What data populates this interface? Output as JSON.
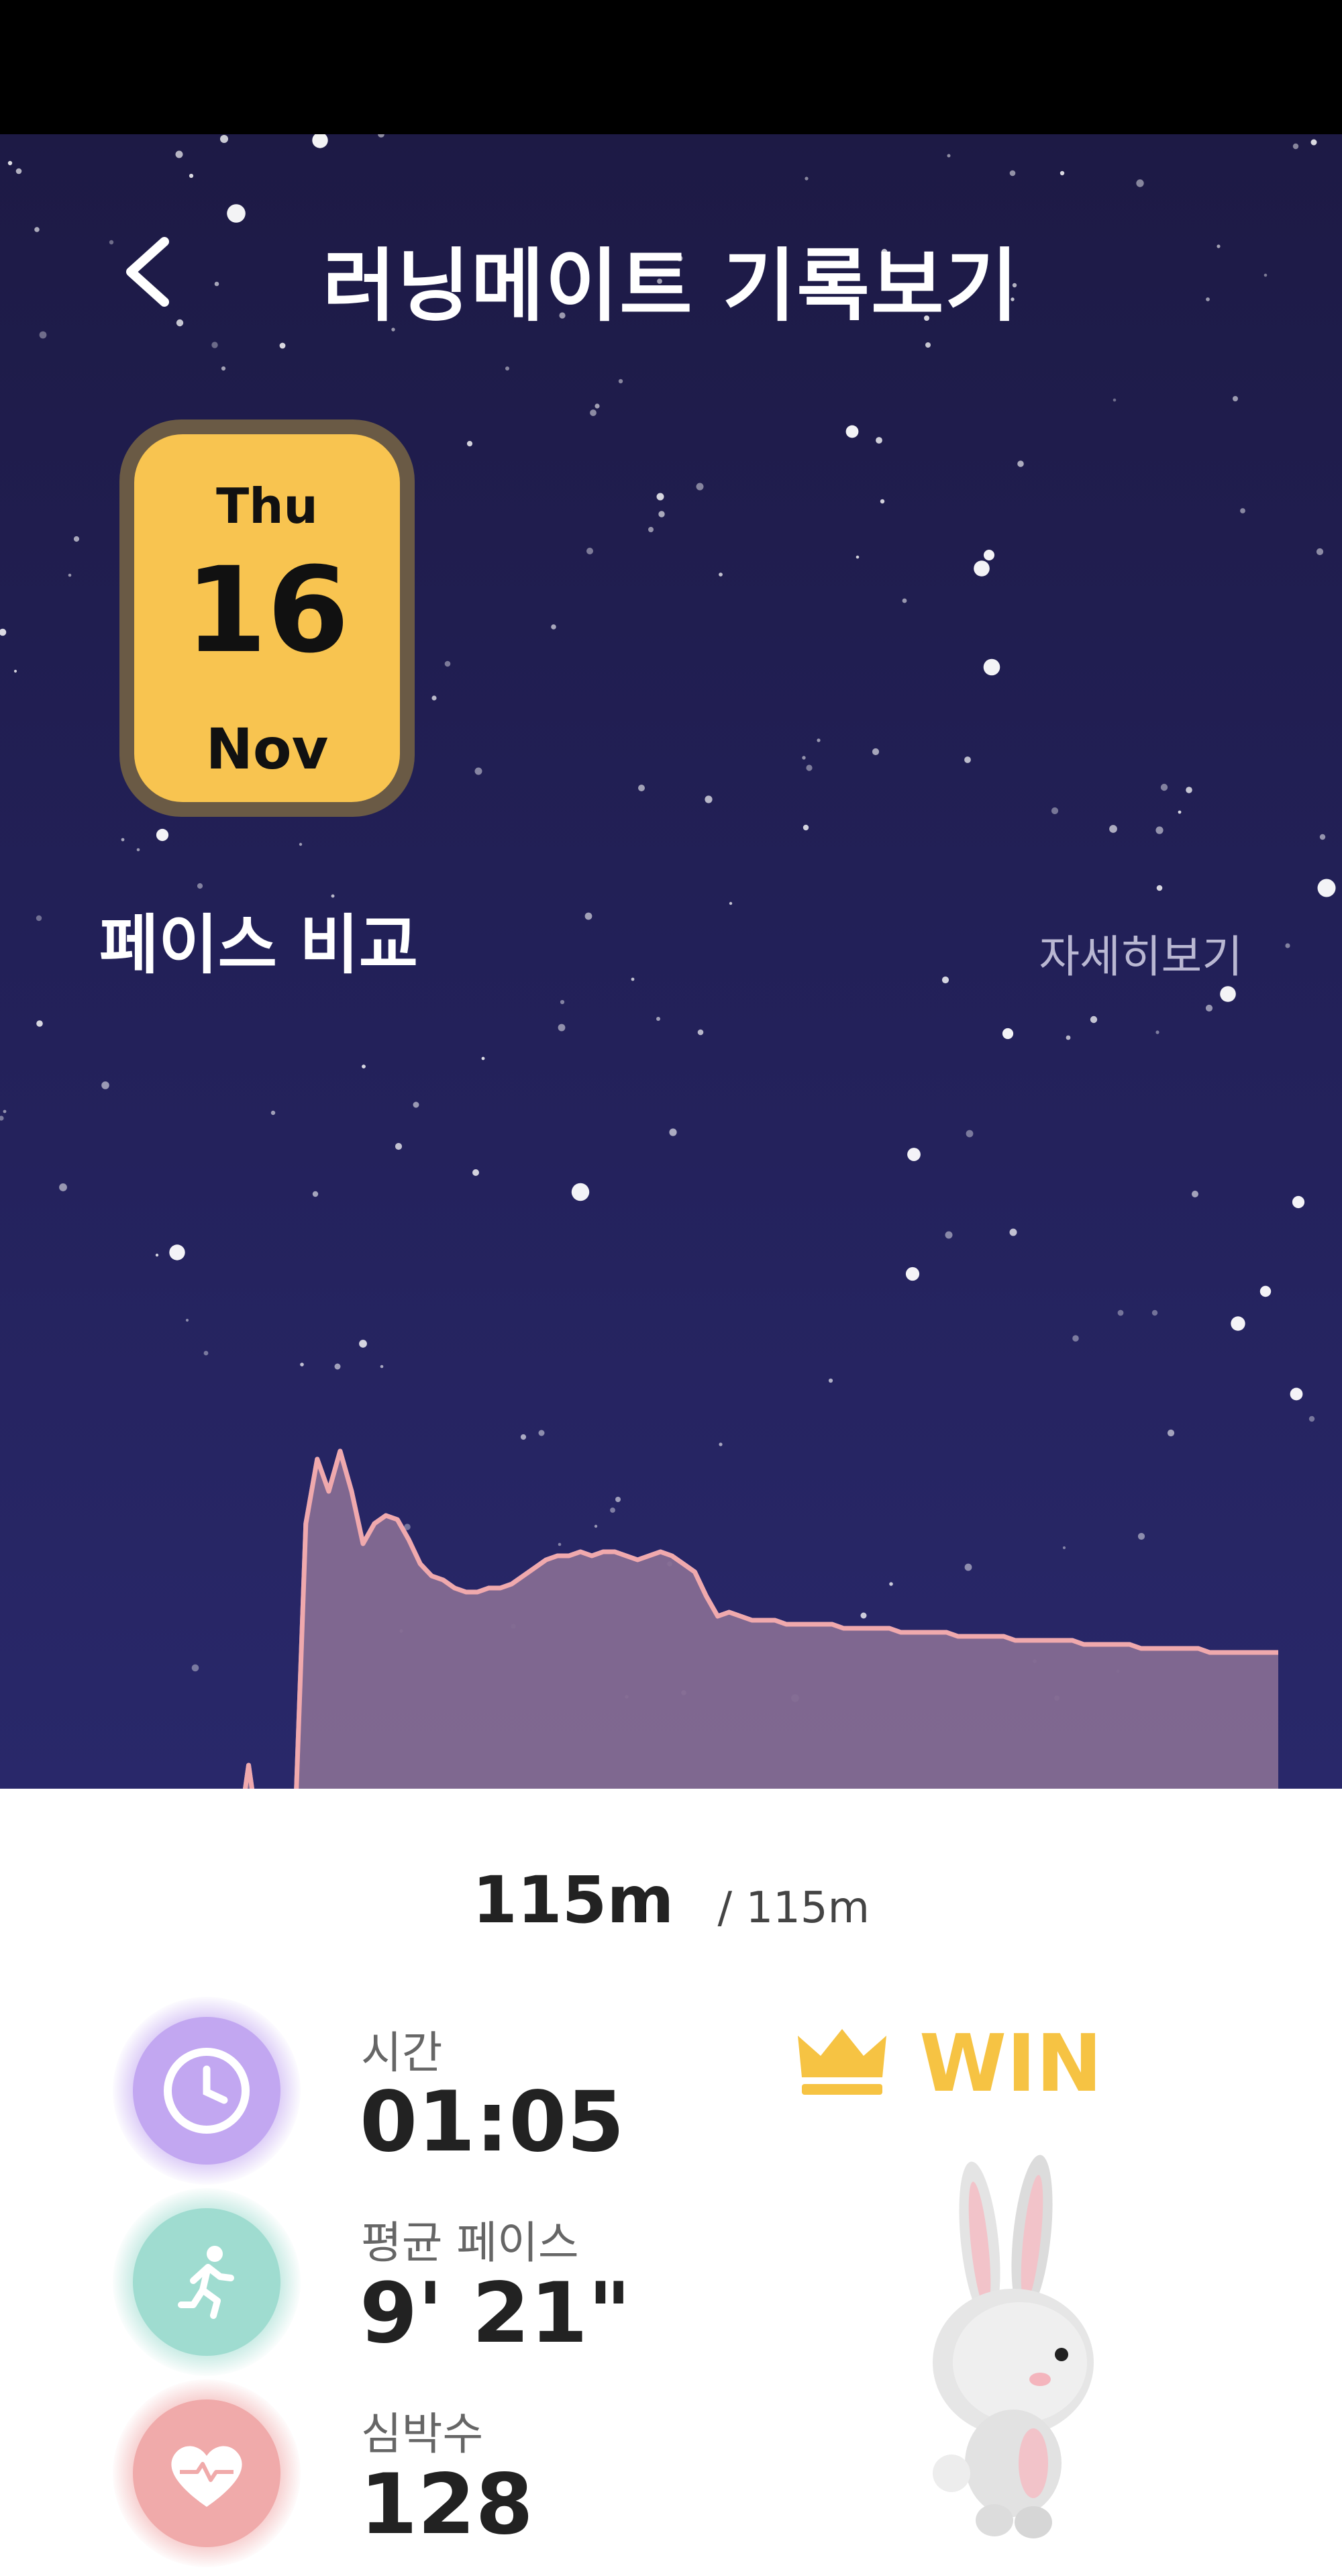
{
  "header": {
    "title": "러닝메이트 기록보기",
    "back_icon": "chevron-left-icon"
  },
  "date_card": {
    "weekday": "Thu",
    "day": "16",
    "month": "Nov"
  },
  "pace_section": {
    "title": "페이스 비교",
    "detail_link": "자세히보기"
  },
  "chart_data": {
    "type": "area",
    "title": "",
    "xlabel": "",
    "ylabel": "",
    "grid": false,
    "x": [
      0,
      1,
      2,
      3,
      4,
      5,
      6,
      7,
      8,
      9,
      10,
      11,
      12,
      13,
      14,
      15,
      16,
      17,
      18,
      19,
      20,
      21,
      22,
      23,
      24,
      25,
      26,
      27,
      28,
      29,
      30,
      31,
      32,
      33,
      34,
      35,
      36,
      37,
      38,
      39,
      40,
      41,
      42,
      43,
      44,
      45,
      46,
      47,
      48,
      49,
      50,
      51,
      52,
      53,
      54,
      55,
      56,
      57,
      58,
      59,
      60,
      61,
      62,
      63,
      64,
      65,
      66,
      67,
      68,
      69,
      70,
      71,
      72,
      73,
      74,
      75,
      76,
      77,
      78,
      79,
      80,
      81,
      82,
      83,
      84,
      85,
      86,
      87,
      88,
      89,
      90,
      91,
      92,
      93,
      94,
      95,
      96,
      97,
      98,
      99,
      100
    ],
    "series": [
      {
        "color": "#9aa7ee",
        "fill": "#5d64a6",
        "values": [
          0,
          0,
          0,
          0,
          0,
          0,
          0,
          0,
          0,
          0,
          20,
          0,
          0,
          0,
          0,
          80,
          96,
          88,
          98,
          88,
          75,
          80,
          82,
          81,
          76,
          70,
          67,
          66,
          64,
          63,
          63,
          64,
          64,
          65,
          67,
          69,
          71,
          72,
          72,
          73,
          72,
          73,
          73,
          72,
          71,
          72,
          73,
          72,
          70,
          68,
          62,
          57,
          58,
          57,
          56,
          56,
          56,
          55,
          55,
          55,
          55,
          55,
          54,
          54,
          54,
          54,
          54,
          53,
          53,
          53,
          53,
          53,
          52,
          52,
          52,
          52,
          52,
          51,
          51,
          51,
          51,
          51,
          51,
          50,
          50,
          50,
          50,
          50,
          49,
          49,
          49,
          49,
          49,
          49,
          48,
          48,
          48,
          48,
          48,
          48,
          48
        ]
      },
      {
        "color": "#f0a9ad",
        "fill": "#8e6c8c",
        "values": [
          0,
          0,
          0,
          0,
          0,
          0,
          0,
          0,
          0,
          0,
          20,
          0,
          0,
          0,
          0,
          80,
          96,
          88,
          98,
          88,
          75,
          80,
          82,
          81,
          76,
          70,
          67,
          66,
          64,
          63,
          63,
          64,
          64,
          65,
          67,
          69,
          71,
          72,
          72,
          73,
          72,
          73,
          73,
          72,
          71,
          72,
          73,
          72,
          70,
          68,
          62,
          57,
          58,
          57,
          56,
          56,
          56,
          55,
          55,
          55,
          55,
          55,
          54,
          54,
          54,
          54,
          54,
          53,
          53,
          53,
          53,
          53,
          52,
          52,
          52,
          52,
          52,
          51,
          51,
          51,
          51,
          51,
          51,
          50,
          50,
          50,
          50,
          50,
          49,
          49,
          49,
          49,
          49,
          49,
          48,
          48,
          48,
          48,
          48,
          48,
          48
        ]
      }
    ],
    "ylim": [
      0,
      100
    ]
  },
  "distance": {
    "current": "115m",
    "total": "/ 115m"
  },
  "metrics": [
    {
      "label": "시간",
      "value": "01:05",
      "icon": "clock-icon",
      "color": "#c2a7f1"
    },
    {
      "label": "평균 페이스",
      "value": "9' 21\"",
      "icon": "runner-icon",
      "color": "#9fdcd0"
    },
    {
      "label": "심박수",
      "value": "128",
      "icon": "heart-icon",
      "color": "#f0aaaa"
    }
  ],
  "result": {
    "label": "WIN",
    "icon": "crown-icon",
    "character": "bunny-character"
  }
}
